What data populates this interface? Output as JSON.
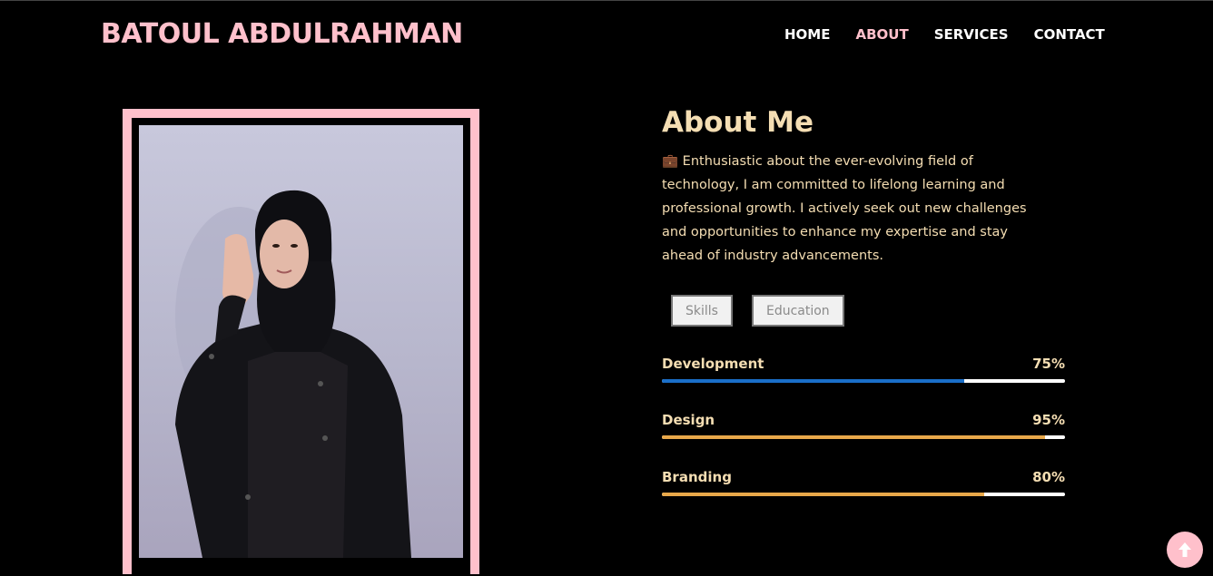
{
  "header": {
    "brand": "BATOUL ABDULRAHMAN",
    "nav": [
      {
        "label": "HOME",
        "active": false
      },
      {
        "label": "ABOUT",
        "active": true
      },
      {
        "label": "SERVICES",
        "active": false
      },
      {
        "label": "CONTACT",
        "active": false
      }
    ]
  },
  "about": {
    "title": "About Me",
    "icon": "briefcase-icon",
    "text": "💼 Enthusiastic about the ever-evolving field of technology, I am committed to lifelong learning and professional growth. I actively seek out new challenges and opportunities to enhance my expertise and stay ahead of industry advancements."
  },
  "tabs": [
    {
      "label": "Skills"
    },
    {
      "label": "Education"
    }
  ],
  "skills": [
    {
      "name": "Development",
      "percent_label": "75%",
      "fraction": 0.75,
      "color": "#1a6fc9"
    },
    {
      "name": "Design",
      "percent_label": "95%",
      "fraction": 0.95,
      "color": "#e8a84a"
    },
    {
      "name": "Branding",
      "percent_label": "80%",
      "fraction": 0.8,
      "color": "#e8a84a"
    }
  ],
  "colors": {
    "accent_pink": "#ffc0cb",
    "text_wheat": "#f5deb3",
    "background": "#000000"
  },
  "scroll_top": {
    "icon": "arrow-up-icon"
  }
}
